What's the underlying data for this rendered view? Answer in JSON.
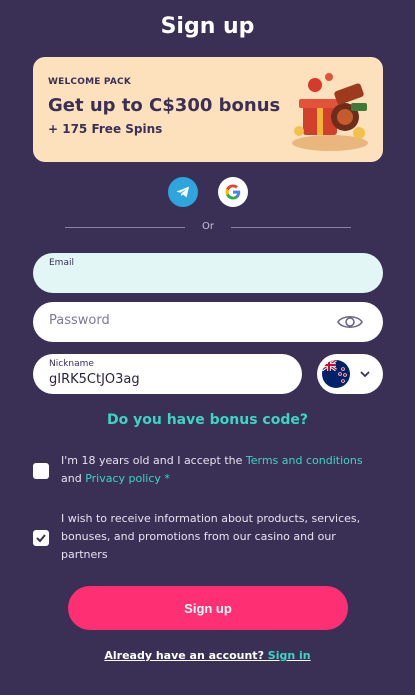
{
  "page": {
    "title": "Sign up"
  },
  "banner": {
    "kicker": "WELCOME PACK",
    "headline": "Get up to C$300 bonus",
    "sub": "+ 175 Free Spins"
  },
  "social": {
    "telegram_icon": "telegram-icon",
    "google_icon": "google-icon"
  },
  "divider": {
    "text": "Or"
  },
  "form": {
    "email": {
      "label": "Email",
      "value": ""
    },
    "password": {
      "placeholder": "Password"
    },
    "nickname": {
      "label": "Nickname",
      "value": "gIRK5CtJO3ag"
    },
    "country": {
      "flag": "new-zealand-flag-icon"
    }
  },
  "bonus_code_link": "Do you have bonus code?",
  "consent": {
    "age": {
      "text_before": "I'm 18 years old and I accept the ",
      "terms_link": "Terms and conditions",
      "and": " and ",
      "privacy_link": "Privacy policy *",
      "checked": false
    },
    "marketing": {
      "text": "I wish to receive information about products, services, bonuses, and promotions from our casino and our partners",
      "checked": true
    }
  },
  "signup_button": "Sign up",
  "signin": {
    "prompt": "Already have an account? ",
    "link": "Sign in"
  },
  "colors": {
    "background": "#3a3056",
    "accent": "#3ad6c5",
    "primary_button": "#ff2f74",
    "banner": "#fde1bd"
  }
}
